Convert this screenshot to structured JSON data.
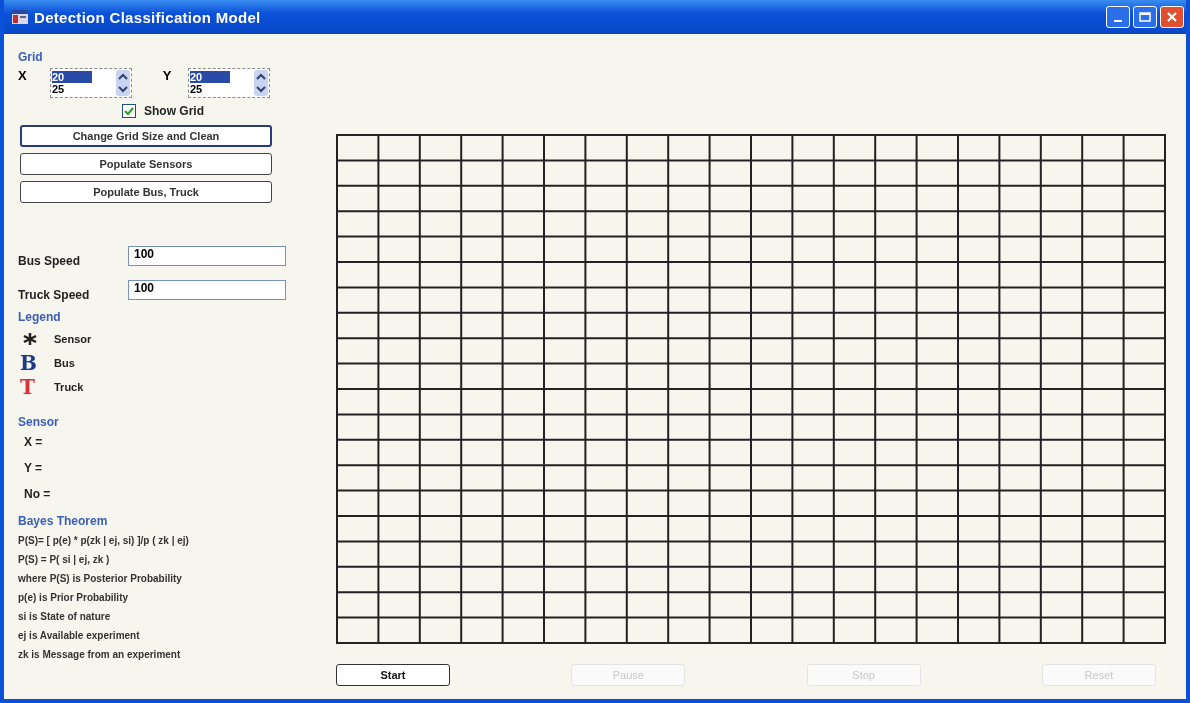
{
  "window": {
    "title": "Detection Classification Model"
  },
  "grid_panel": {
    "title": "Grid",
    "x_label": "X",
    "y_label": "Y",
    "x_spinner": {
      "selected_value": "20",
      "value": "25"
    },
    "y_spinner": {
      "selected_value": "20",
      "value": "25"
    },
    "show_grid": {
      "label": "Show Grid",
      "checked": true
    }
  },
  "action_buttons": [
    {
      "label": "Change Grid Size and Clean",
      "focused": true
    },
    {
      "label": "Populate Sensors",
      "focused": false
    },
    {
      "label": "Populate Bus, Truck",
      "focused": false
    }
  ],
  "speeds": [
    {
      "label": "Bus Speed",
      "value": "100"
    },
    {
      "label": "Truck Speed",
      "value": "100"
    }
  ],
  "legend": {
    "title": "Legend",
    "items": [
      {
        "kind": "asterisk",
        "label": "Sensor"
      },
      {
        "kind": "letter",
        "symbol": "B",
        "color": "#1f3a8a",
        "label": "Bus"
      },
      {
        "kind": "letter",
        "symbol": "T",
        "color": "#d9303a",
        "label": "Truck"
      }
    ]
  },
  "sensor": {
    "title": "Sensor",
    "fields": [
      "X =",
      "Y =",
      "No ="
    ]
  },
  "bayes": {
    "title": "Bayes Theorem",
    "lines": [
      "P(S)= [ p(e) * p(zk | ej, si) ]/p ( zk | ej)",
      "P(S) = P( si | ej, zk )",
      "where P(S) is Posterior Probability",
      "p(e) is Prior Probability",
      "si is State of nature",
      "ej is Available experiment",
      "zk is Message from an experiment"
    ]
  },
  "controls": [
    {
      "label": "Start",
      "disabled": false
    },
    {
      "label": "Pause",
      "disabled": true
    },
    {
      "label": "Stop",
      "disabled": true
    },
    {
      "label": "Reset",
      "disabled": true
    }
  ]
}
